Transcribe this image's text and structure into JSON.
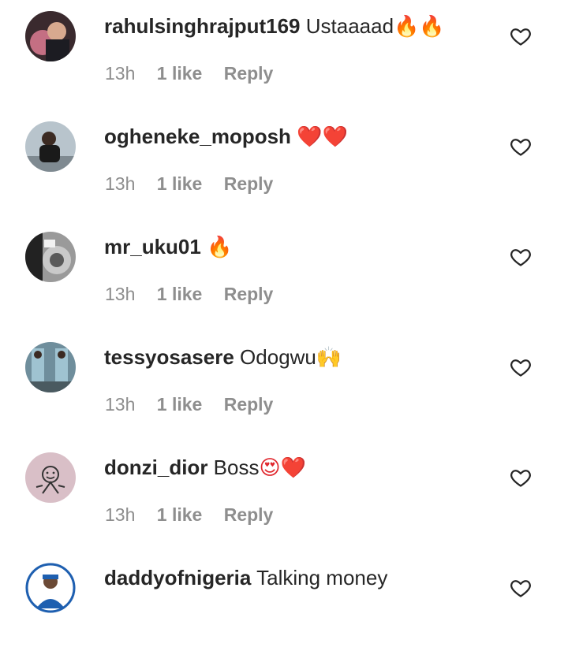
{
  "comments": [
    {
      "username": "rahulsinghrajput169",
      "text": "Ustaaaad",
      "emoji": "🔥🔥",
      "time": "13h",
      "likes": "1 like",
      "reply": "Reply",
      "avatar_color": "#3a2a2e"
    },
    {
      "username": "ogheneke_moposh",
      "text": "",
      "emoji": "❤️❤️",
      "time": "13h",
      "likes": "1 like",
      "reply": "Reply",
      "avatar_color": "#b8c4cc"
    },
    {
      "username": "mr_uku01",
      "text": "",
      "emoji": "🔥",
      "time": "13h",
      "likes": "1 like",
      "reply": "Reply",
      "avatar_color": "#9a9a9a"
    },
    {
      "username": "tessyosasere",
      "text": "Odogwu",
      "emoji": "🙌",
      "time": "13h",
      "likes": "1 like",
      "reply": "Reply",
      "avatar_color": "#6f8e9c"
    },
    {
      "username": "donzi_dior",
      "text": "Boss",
      "emoji": "😍❤️",
      "time": "13h",
      "likes": "1 like",
      "reply": "Reply",
      "avatar_color": "#d9bfc7"
    },
    {
      "username": "daddyofnigeria",
      "text": "Talking money",
      "emoji": "",
      "time": "",
      "likes": "",
      "reply": "",
      "avatar_color": "#1e5fb0"
    }
  ]
}
